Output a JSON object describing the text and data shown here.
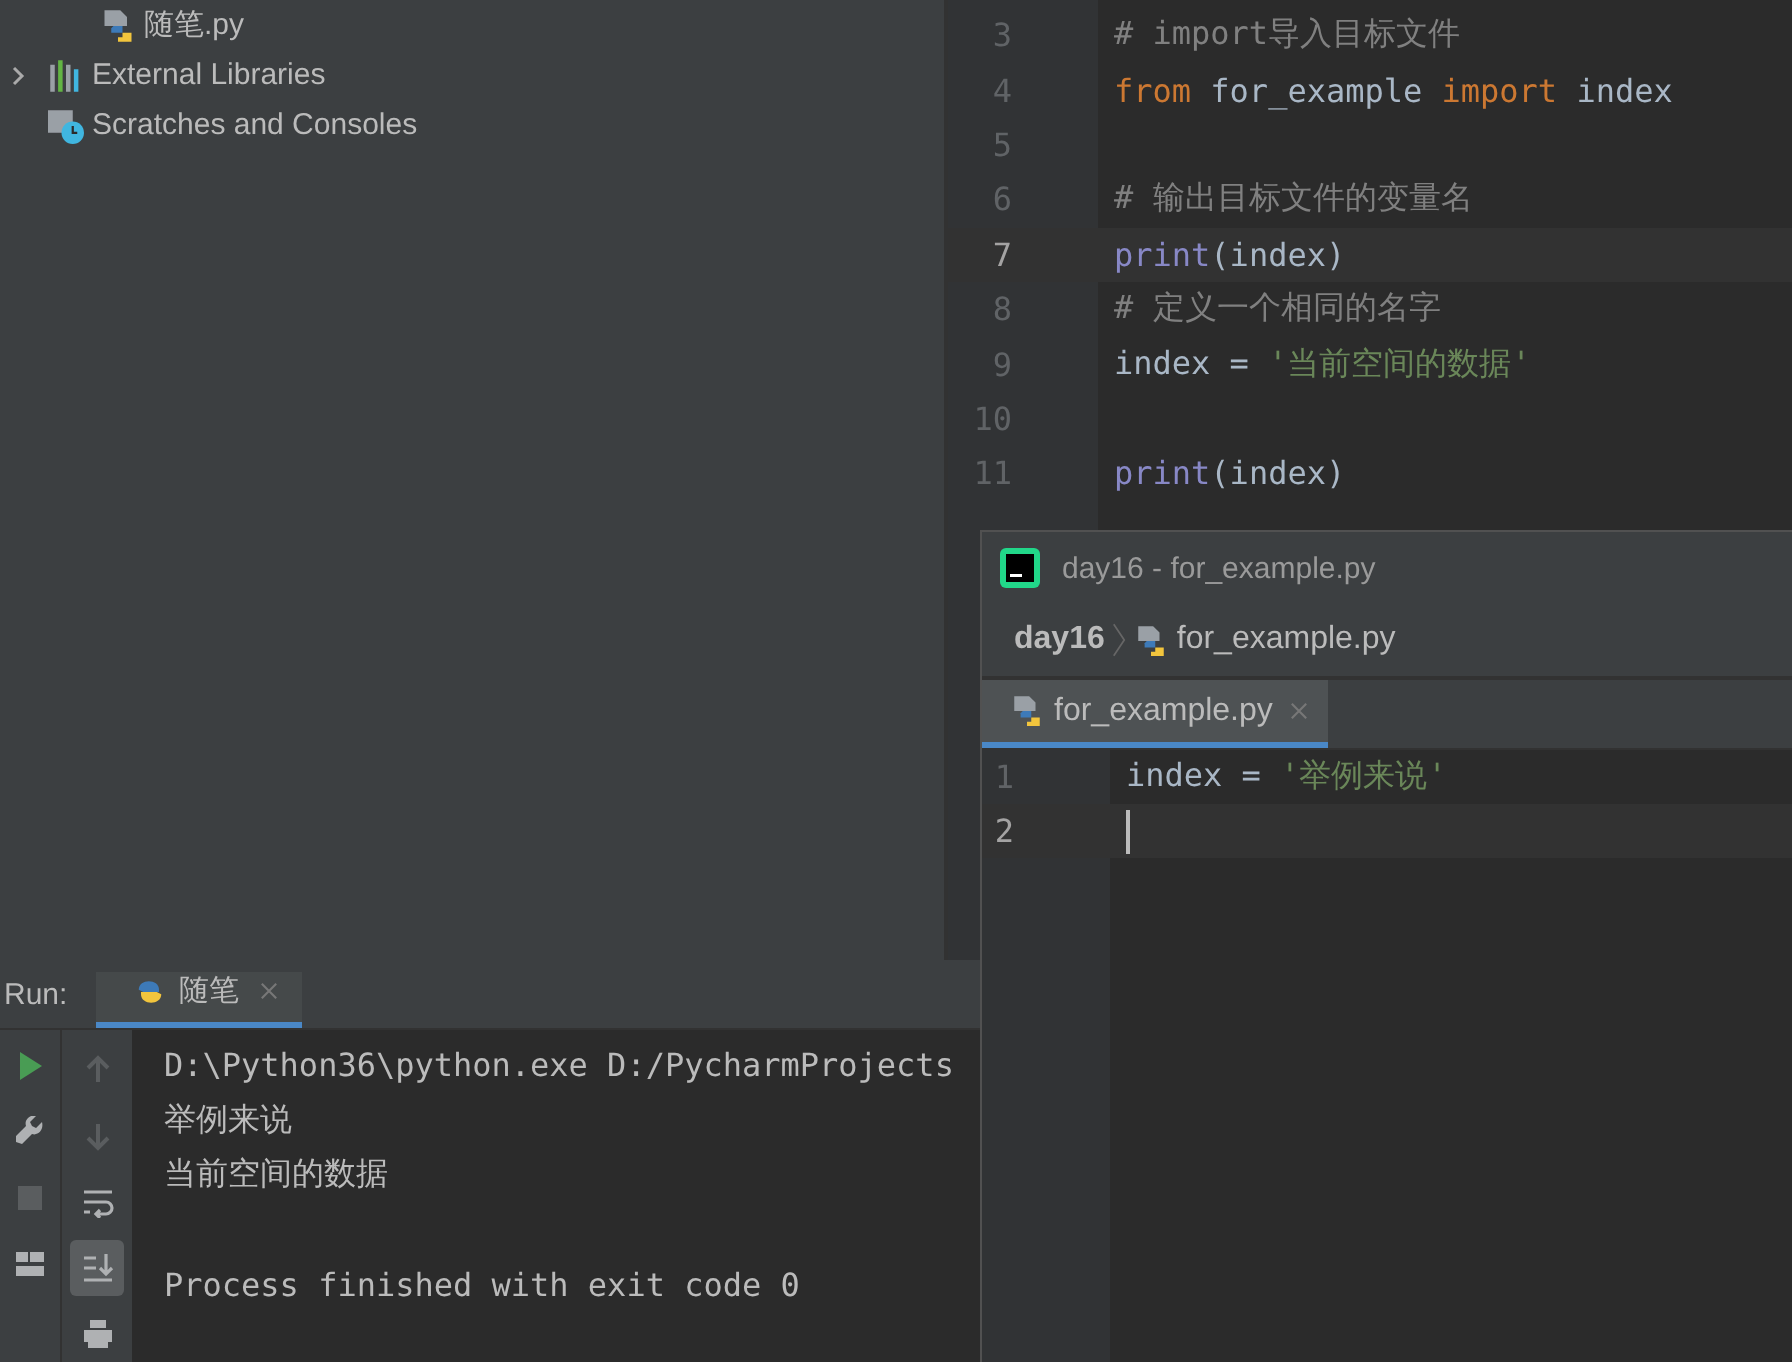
{
  "project_tree": [
    {
      "label": "随笔.py",
      "kind": "python-file"
    },
    {
      "label": "External Libraries",
      "kind": "libraries",
      "expanded": false
    },
    {
      "label": "Scratches and Consoles",
      "kind": "scratches"
    }
  ],
  "editor": {
    "lines": [
      {
        "number": "3",
        "current": false,
        "tokens": [
          {
            "kind": "comment",
            "text": "# import导入目标文件"
          }
        ]
      },
      {
        "number": "4",
        "current": false,
        "tokens": [
          {
            "kind": "keyword",
            "text": "from"
          },
          {
            "kind": "plain",
            "text": " for_example "
          },
          {
            "kind": "keyword",
            "text": "import"
          },
          {
            "kind": "plain",
            "text": " index"
          }
        ]
      },
      {
        "number": "5",
        "current": false
      },
      {
        "number": "6",
        "current": false,
        "tokens": [
          {
            "kind": "comment",
            "text": "# 输出目标文件的变量名"
          }
        ]
      },
      {
        "number": "7",
        "current": true,
        "tokens": [
          {
            "kind": "builtin",
            "text": "print"
          },
          {
            "kind": "plain",
            "text": "(index)"
          }
        ]
      },
      {
        "number": "8",
        "current": false,
        "tokens": [
          {
            "kind": "comment",
            "text": "# 定义一个相同的名字"
          }
        ]
      },
      {
        "number": "9",
        "current": false,
        "tokens": [
          {
            "kind": "plain",
            "text": "index = "
          },
          {
            "kind": "string",
            "text": "'当前空间的数据'"
          }
        ]
      },
      {
        "number": "10",
        "current": false
      },
      {
        "number": "11",
        "current": false,
        "tokens": [
          {
            "kind": "builtin",
            "text": "print"
          },
          {
            "kind": "plain",
            "text": "(index)"
          }
        ]
      }
    ]
  },
  "run_panel": {
    "label": "Run:",
    "tabs": [
      {
        "label": "随笔",
        "selected": true
      }
    ],
    "toolbar": [
      {
        "kind": "run"
      },
      {
        "kind": "wrench"
      },
      {
        "kind": "stop"
      },
      {
        "kind": "layout"
      }
    ],
    "console_toolbar": [
      {
        "kind": "up",
        "selected": false
      },
      {
        "kind": "down",
        "selected": false
      },
      {
        "kind": "wrap",
        "selected": false
      },
      {
        "kind": "scroll-end",
        "selected": true
      },
      {
        "kind": "print",
        "selected": false
      }
    ],
    "output": [
      {
        "text": "D:\\Python36\\python.exe D:/PycharmProjects"
      },
      {
        "text": "举例来说"
      },
      {
        "text": "当前空间的数据"
      },
      {
        "text": "Process finished with exit code 0",
        "gap_before": true
      }
    ]
  },
  "second_window": {
    "title": "day16 - for_example.py",
    "breadcrumb": [
      "day16",
      "for_example.py"
    ],
    "tabs": [
      {
        "label": "for_example.py",
        "selected": true
      }
    ],
    "lines": [
      {
        "number": "1",
        "current": false,
        "tokens": [
          {
            "kind": "plain",
            "text": "index = "
          },
          {
            "kind": "string",
            "text": "'举例来说'"
          }
        ]
      },
      {
        "number": "2",
        "current": true,
        "caret": true
      }
    ]
  }
}
